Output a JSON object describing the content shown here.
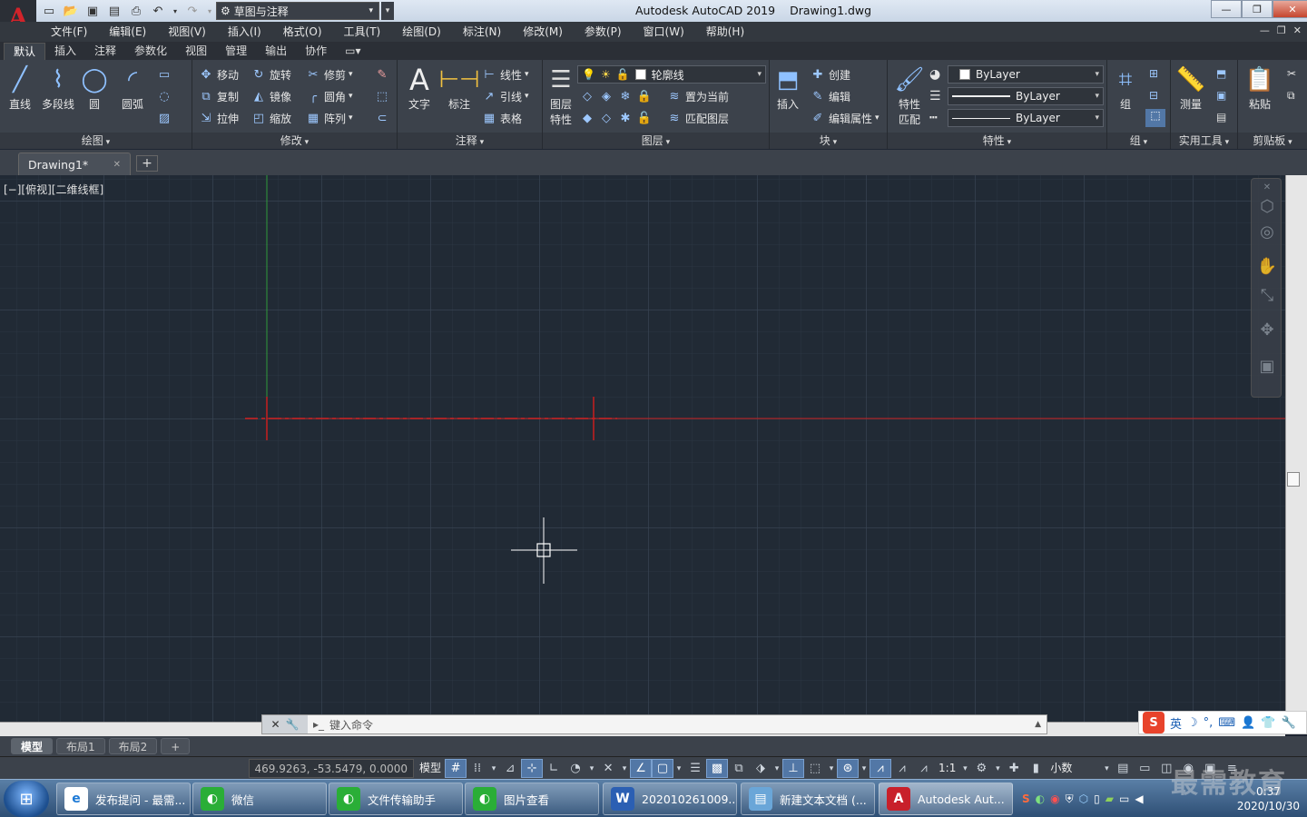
{
  "titlebar": {
    "app": "Autodesk AutoCAD 2019",
    "file": "Drawing1.dwg",
    "logo": "A",
    "workspace": "草图与注释"
  },
  "menu": [
    "文件(F)",
    "编辑(E)",
    "视图(V)",
    "插入(I)",
    "格式(O)",
    "工具(T)",
    "绘图(D)",
    "标注(N)",
    "修改(M)",
    "参数(P)",
    "窗口(W)",
    "帮助(H)"
  ],
  "ribbon_tabs": [
    "默认",
    "插入",
    "注释",
    "参数化",
    "视图",
    "管理",
    "输出",
    "协作"
  ],
  "panels": {
    "draw": {
      "title": "绘图",
      "line": "直线",
      "polyline": "多段线",
      "circle": "圆",
      "arc": "圆弧"
    },
    "modify": {
      "title": "修改",
      "move": "移动",
      "rotate": "旋转",
      "trim": "修剪",
      "copy": "复制",
      "mirror": "镜像",
      "fillet": "圆角",
      "stretch": "拉伸",
      "scale": "缩放",
      "array": "阵列"
    },
    "annotation": {
      "title": "注释",
      "text": "文字",
      "dimension": "标注",
      "linear": "线性",
      "leader": "引线",
      "table": "表格"
    },
    "layers": {
      "title": "图层",
      "props_line1": "图层",
      "props_line2": "特性",
      "current_layer": "轮廓线",
      "set_current": "置为当前",
      "match_layer": "匹配图层"
    },
    "block": {
      "title": "块",
      "insert": "插入",
      "create": "创建",
      "edit": "编辑",
      "edit_attr": "编辑属性"
    },
    "properties": {
      "title": "特性",
      "match_line1": "特性",
      "match_line2": "匹配",
      "color": "ByLayer",
      "linetype": "ByLayer",
      "lineweight": "ByLayer"
    },
    "groups": {
      "title": "组",
      "group": "组"
    },
    "utilities": {
      "title": "实用工具",
      "measure": "测量"
    },
    "clipboard": {
      "title": "剪贴板",
      "paste": "粘贴"
    }
  },
  "doc_tab": {
    "name": "Drawing1*"
  },
  "viewport_label": "[−][俯视][二维线框]",
  "command": {
    "placeholder": "键入命令"
  },
  "layout_tabs": [
    "模型",
    "布局1",
    "布局2"
  ],
  "status": {
    "coords": "469.9263, -53.5479, 0.0000",
    "model": "模型",
    "scale": "1:1",
    "units": "小数"
  },
  "ime": {
    "lang": "英"
  },
  "taskbar": {
    "items": [
      {
        "label": "发布提问 - 最需...",
        "icon": "ie-icon",
        "color": "#1e7ad6"
      },
      {
        "label": "微信",
        "icon": "wechat-icon",
        "color": "#2aae37"
      },
      {
        "label": "文件传输助手",
        "icon": "wechat-icon",
        "color": "#2aae37"
      },
      {
        "label": "图片查看",
        "icon": "wechat-icon",
        "color": "#2aae37"
      },
      {
        "label": "202010261009...",
        "icon": "word-icon",
        "color": "#2b5fb3"
      },
      {
        "label": "新建文本文档 (...",
        "icon": "notepad-icon",
        "color": "#6aa6d8"
      },
      {
        "label": "Autodesk Aut...",
        "icon": "autocad-icon",
        "color": "#c8202a"
      }
    ],
    "clock_time": "0:37",
    "clock_date": "2020/10/30"
  },
  "watermark": "最需教育",
  "colors": {
    "canvas": "#212a35",
    "ucs_x": "#c81e1e",
    "ucs_y": "#2f9a3a",
    "cursor": "#ffffff",
    "accent": "#5277a6"
  }
}
